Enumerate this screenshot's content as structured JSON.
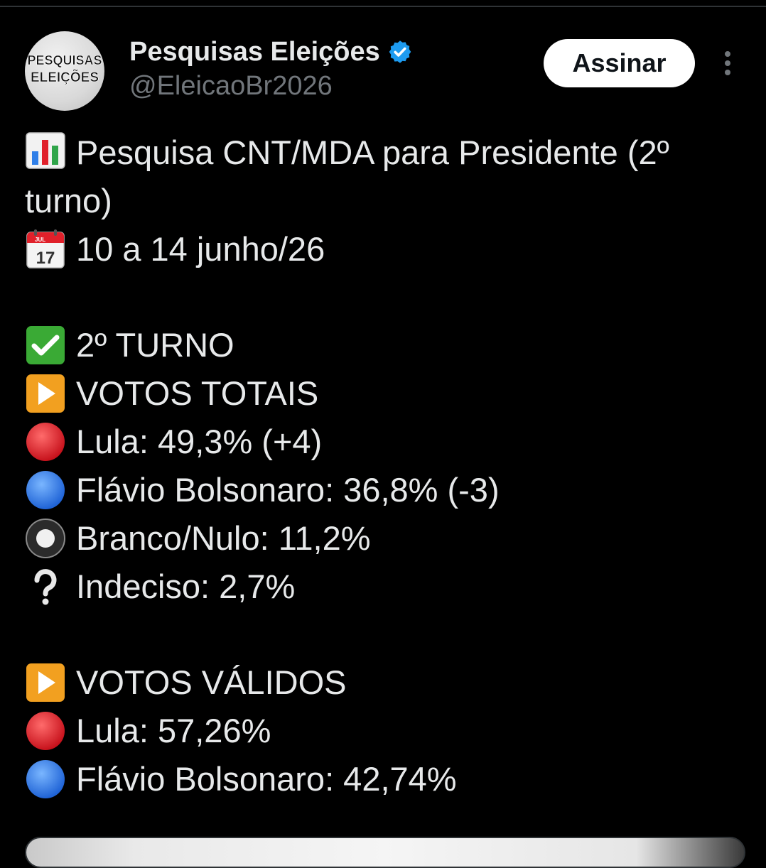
{
  "tweet": {
    "author": {
      "display_name": "Pesquisas Eleições",
      "handle": "@EleicaoBr2026",
      "verified": true,
      "avatar_text_top": "PESQUISAS",
      "avatar_text_bottom": "ELEIÇÕES"
    },
    "subscribe_label": "Assinar",
    "more_icon": "vertical-ellipsis-icon",
    "lines": {
      "title": "Pesquisa CNT/MDA para Presidente (2º turno)",
      "date": "10 a 14 junho/26",
      "round": "2º TURNO",
      "total_header": "VOTOS TOTAIS",
      "total_lula": "Lula: 49,3% (+4)",
      "total_flavio": "Flávio Bolsonaro: 36,8% (-3)",
      "total_blank": "Branco/Nulo: 11,2%",
      "total_undecided": "Indeciso: 2,7%",
      "valid_header": "VOTOS VÁLIDOS",
      "valid_lula": "Lula: 57,26%",
      "valid_flavio": "Flávio Bolsonaro: 42,74%"
    },
    "calendar_icon": {
      "month": "JUL",
      "day": "17"
    },
    "colors": {
      "background": "#000000",
      "text": "#e7e9ea",
      "muted": "#71767b",
      "verified": "#1d9bf0",
      "red_circle": "#e0202a",
      "blue_circle": "#2f7fe8"
    }
  }
}
